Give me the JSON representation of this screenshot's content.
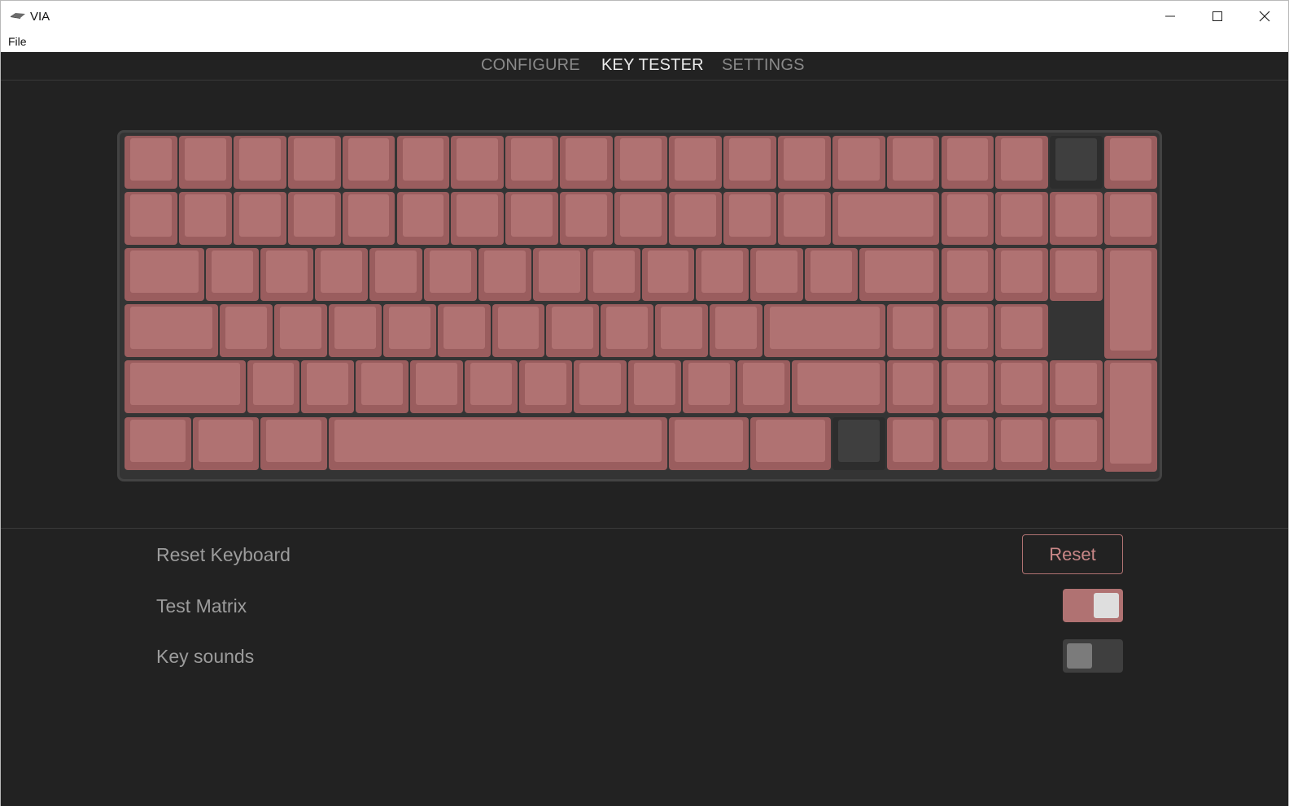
{
  "window": {
    "title": "VIA",
    "controls": {
      "minimize": "minimize-icon",
      "maximize": "maximize-icon",
      "close": "close-icon"
    }
  },
  "menu": {
    "file": "File"
  },
  "tabs": [
    {
      "label": "CONFIGURE",
      "active": false
    },
    {
      "label": "KEY TESTER",
      "active": true
    },
    {
      "label": "SETTINGS",
      "active": false
    }
  ],
  "keyboard": {
    "pressed_color": "#b07272",
    "unpressed_color": "#3f3f3f"
  },
  "settings": {
    "reset_keyboard_label": "Reset Keyboard",
    "reset_button": "Reset",
    "test_matrix_label": "Test Matrix",
    "test_matrix_on": true,
    "key_sounds_label": "Key sounds",
    "key_sounds_on": false
  },
  "colors": {
    "accent": "#b07272",
    "background": "#222222"
  }
}
